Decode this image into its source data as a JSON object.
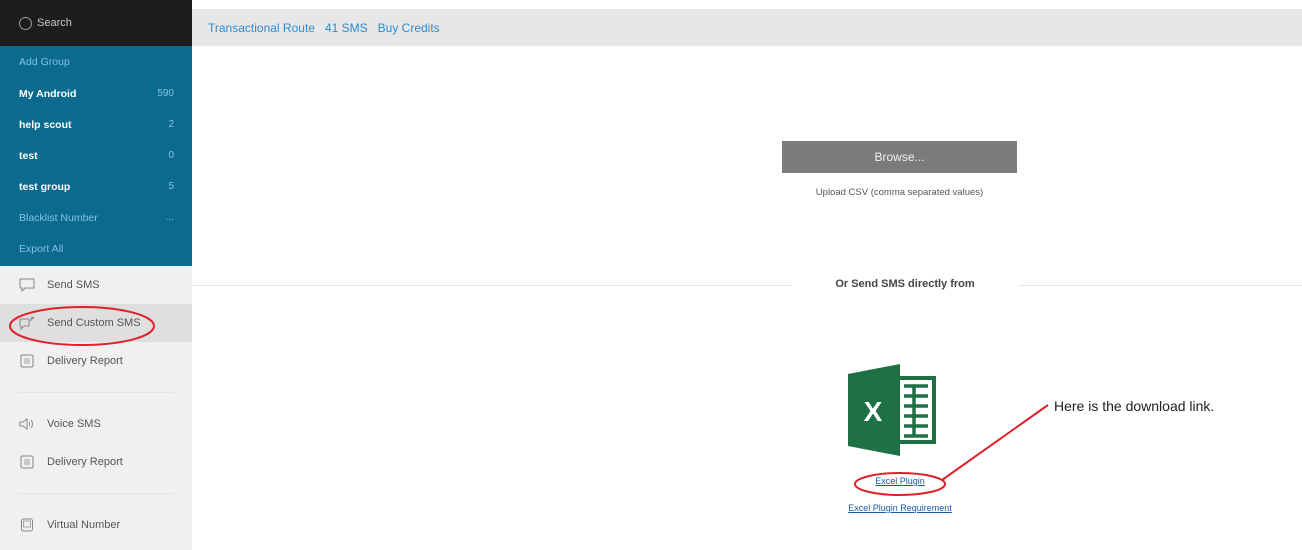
{
  "sidebar": {
    "search_label": "Search",
    "groups": [
      {
        "label": "Add Group",
        "count": "",
        "link": true
      },
      {
        "label": "My Android",
        "count": "590",
        "link": false
      },
      {
        "label": "help scout",
        "count": "2",
        "link": false
      },
      {
        "label": "test",
        "count": "0",
        "link": false
      },
      {
        "label": "test group",
        "count": "5",
        "link": false
      },
      {
        "label": "Blacklist Number",
        "count": "...",
        "link": true
      },
      {
        "label": "Export All",
        "count": "",
        "link": true
      }
    ],
    "menu": {
      "send_sms": "Send SMS",
      "send_custom_sms": "Send Custom SMS",
      "delivery_report_1": "Delivery Report",
      "voice_sms": "Voice SMS",
      "delivery_report_2": "Delivery Report",
      "virtual_number": "Virtual Number"
    }
  },
  "topbar": {
    "route": "Transactional Route",
    "sms_count": "41 SMS",
    "buy_credits": "Buy Credits"
  },
  "main": {
    "browse_label": "Browse...",
    "upload_hint": "Upload CSV (comma separated values)",
    "or_send_label": "Or Send SMS directly from",
    "excel_plugin": "Excel Plugin",
    "excel_plugin_requirement": "Excel Plugin Requirement",
    "annotation_text": "Here is the download link."
  },
  "colors": {
    "sidebar_group_bg": "#0c6a8f",
    "search_bg": "#1d1d1d",
    "link_blue": "#2e8ccf",
    "annotation_red": "#e0202a",
    "excel_green": "#1e7145"
  },
  "icons": {
    "search": "search-icon",
    "send_sms": "speech-bubble-icon",
    "send_custom_sms": "edit-bubble-icon",
    "delivery_report": "document-icon",
    "voice_sms": "speaker-icon",
    "virtual_number": "phone-icon",
    "excel": "excel-icon"
  }
}
